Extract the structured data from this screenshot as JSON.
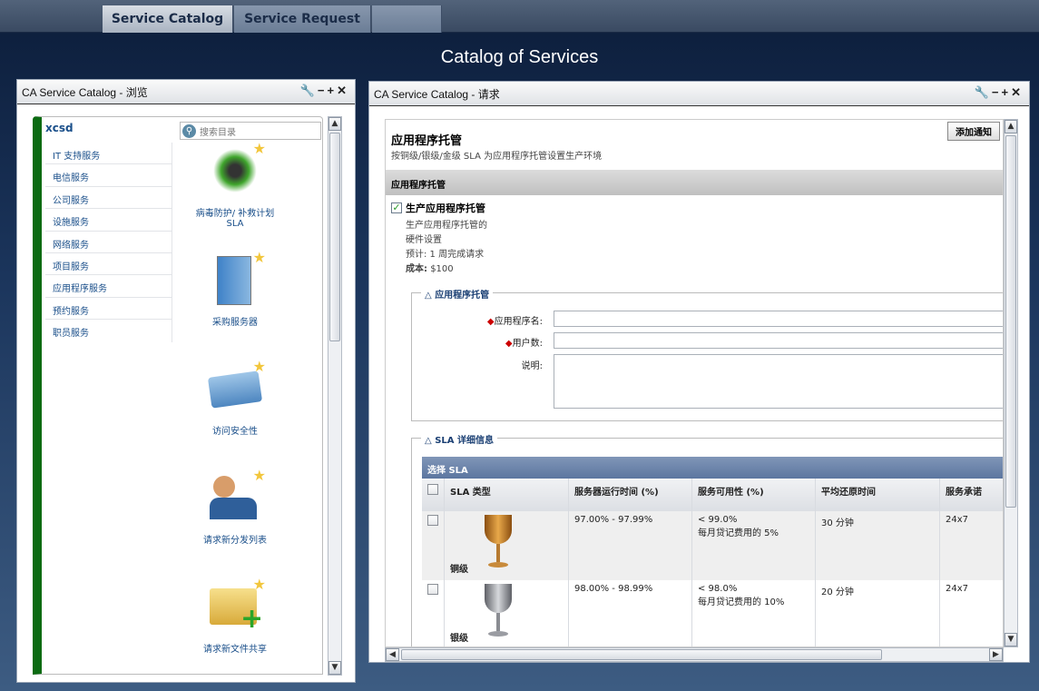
{
  "nav": {
    "tabs": [
      {
        "label": "Service Catalog",
        "active": true
      },
      {
        "label": "Service Request",
        "active": false
      }
    ]
  },
  "page_title": "Catalog of Services",
  "browse": {
    "title": "CA Service Catalog - 浏览",
    "root": "xcsd",
    "search_placeholder": "搜索目录",
    "categories": [
      "IT 支持服务",
      "电信服务",
      "公司服务",
      "设施服务",
      "网络服务",
      "项目服务",
      "应用程序服务",
      "预约服务",
      "职员服务"
    ],
    "services": [
      {
        "label": "病毒防护/ 补救计划 SLA",
        "icon": "virus-icon"
      },
      {
        "label": "采购服务器",
        "icon": "server-icon"
      },
      {
        "label": "访问安全性",
        "icon": "id-card-icon"
      },
      {
        "label": "请求新分发列表",
        "icon": "users-mail-icon"
      },
      {
        "label": "请求新文件共享",
        "icon": "folder-add-icon"
      }
    ]
  },
  "request": {
    "title": "CA Service Catalog - 请求",
    "add_notify": "添加通知",
    "heading": "应用程序托管",
    "subheading": "按铜级/银级/金级 SLA 为应用程序托管设置生产环境",
    "section_bar": "应用程序托管",
    "option": {
      "label": "生产应用程序托管",
      "checked": true,
      "desc1": "生产应用程序托管的",
      "desc2": "硬件设置",
      "estimate": "预计: 1 周完成请求",
      "cost_label": "成本:",
      "cost_value": "$100"
    },
    "form": {
      "legend": "应用程序托管",
      "fields": [
        {
          "label": "应用程序名:",
          "required": true,
          "value": ""
        },
        {
          "label": "用户数:",
          "required": true,
          "value": ""
        },
        {
          "label": "说明:",
          "required": false,
          "value": ""
        }
      ]
    },
    "sla": {
      "legend": "SLA 详细信息",
      "table_title": "选择 SLA",
      "columns": [
        "SLA 类型",
        "服务器运行时间 (%)",
        "服务可用性 (%)",
        "平均还原时间",
        "服务承诺"
      ],
      "rows": [
        {
          "type": "铜级",
          "uptime": "97.00% - 97.99%",
          "avail1": "< 99.0%",
          "avail2": "每月贷记费用的 5%",
          "restore": "30 分钟",
          "commit": "24x7",
          "color": "#c8862a"
        },
        {
          "type": "银级",
          "uptime": "98.00% - 98.99%",
          "avail1": "< 98.0%",
          "avail2": "每月贷记费用的 10%",
          "restore": "20 分钟",
          "commit": "24x7",
          "color": "#9a9ca2"
        }
      ]
    }
  }
}
